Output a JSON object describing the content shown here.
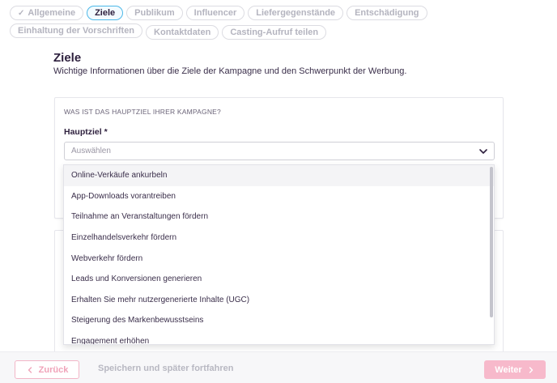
{
  "tabs_row1": [
    {
      "label": "Allgemeine",
      "checked": true
    },
    {
      "label": "Ziele",
      "active": true
    },
    {
      "label": "Publikum"
    },
    {
      "label": "Influencer"
    },
    {
      "label": "Liefergegenstände"
    },
    {
      "label": "Entschädigung"
    },
    {
      "label": "Einhaltung der Vorschriften"
    }
  ],
  "tabs_row2": [
    {
      "label": "Kontaktdaten"
    },
    {
      "label": "Casting-Aufruf teilen"
    }
  ],
  "page": {
    "title": "Ziele",
    "subtitle": "Wichtige Informationen über die Ziele der Kampagne und den Schwerpunkt der Werbung."
  },
  "card": {
    "question": "WAS IST DAS HAUPTZIEL IHRER KAMPAGNE?",
    "field_label": "Hauptziel *",
    "select_placeholder": "Auswählen"
  },
  "dropdown": {
    "options": [
      "Online-Verkäufe ankurbeln",
      "App-Downloads vorantreiben",
      "Teilnahme an Veranstaltungen fördern",
      "Einzelhandelsverkehr fördern",
      "Webverkehr fördern",
      "Leads und Konversionen generieren",
      "Erhalten Sie mehr nutzergenerierte Inhalte (UGC)",
      "Steigerung des Markenbewusstseins",
      "Engagement erhöhen"
    ],
    "highlighted_index": 0
  },
  "footer": {
    "back_label": "Zurück",
    "save_label": "Speichern und später fortfahren",
    "next_label": "Weiter"
  },
  "colors": {
    "accent_pink": "#f7b9cb",
    "active_tab_border": "#4db8e8",
    "text_dark": "#2d1f3d"
  }
}
